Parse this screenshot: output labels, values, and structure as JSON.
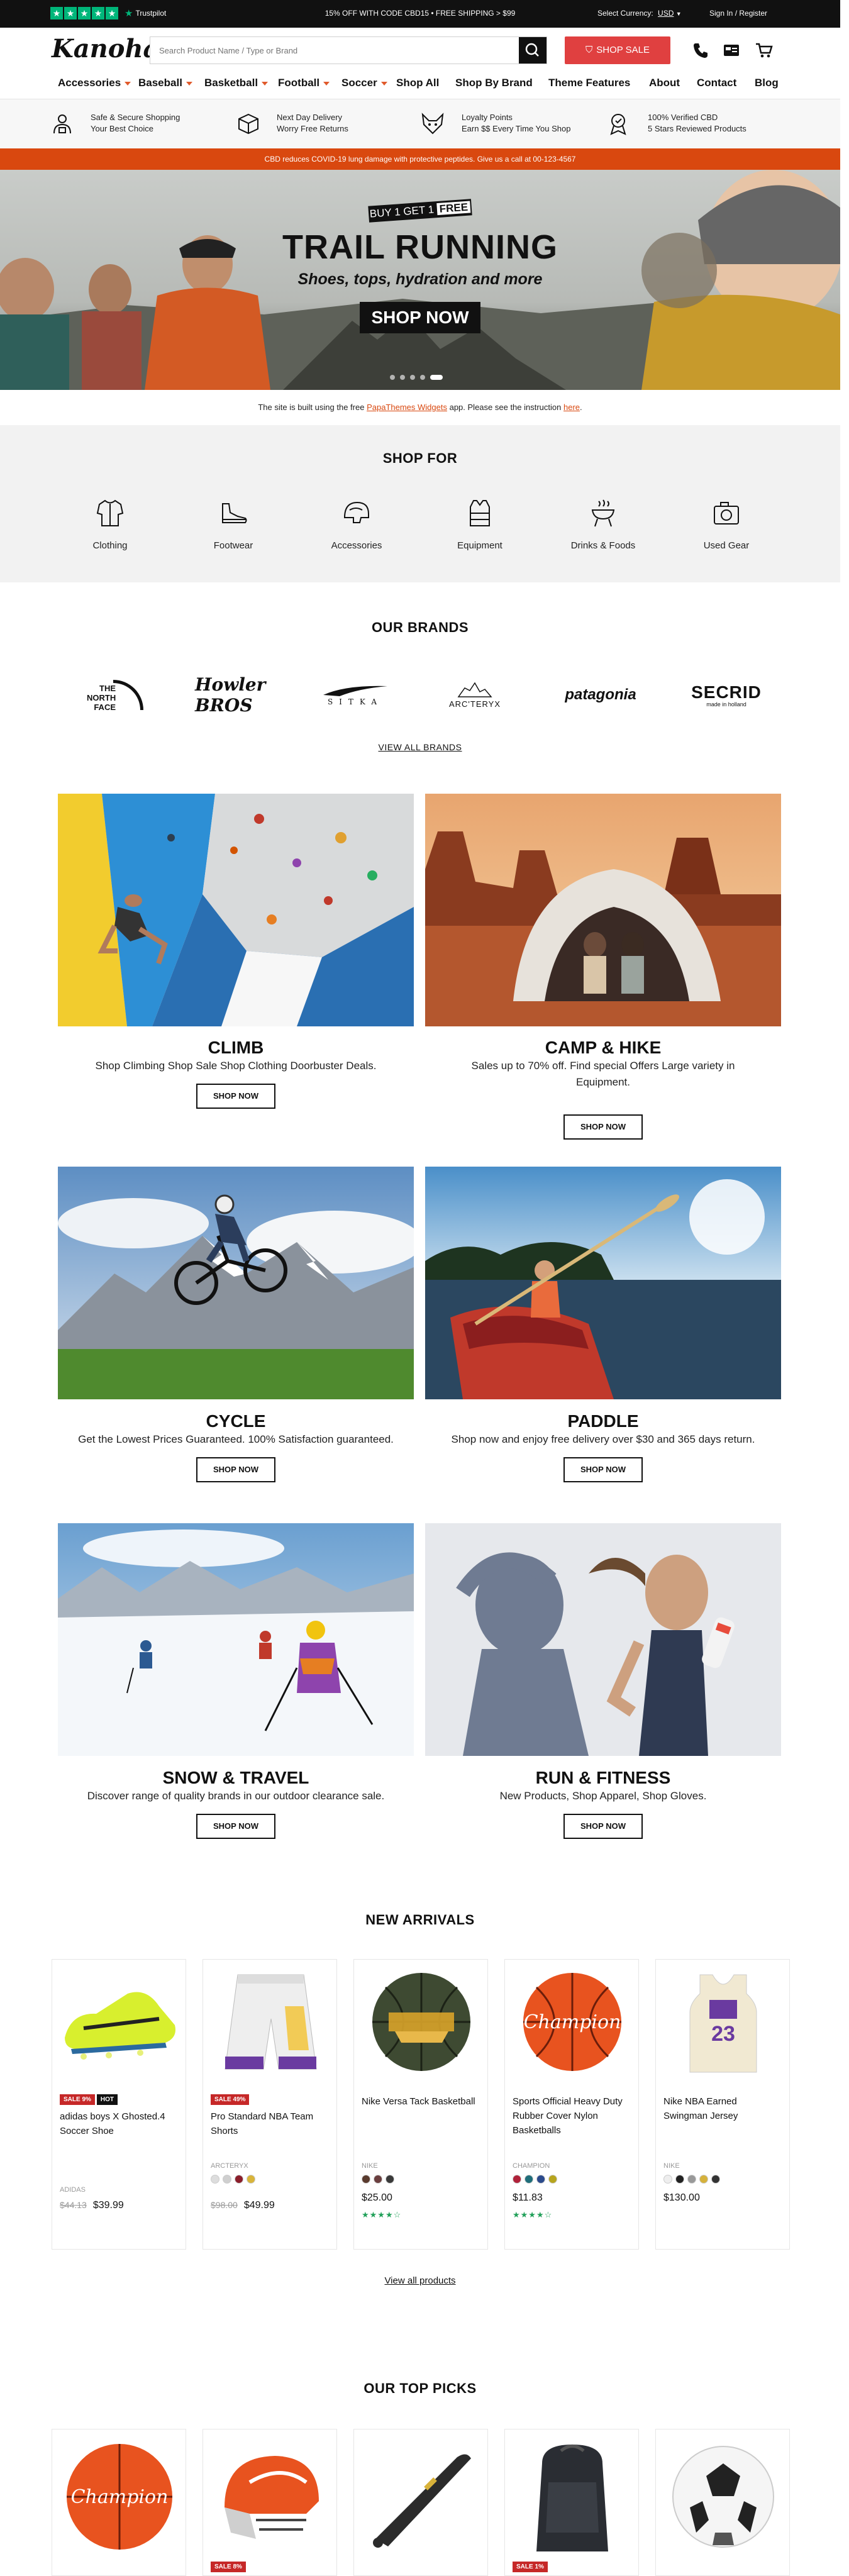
{
  "topbar": {
    "trustpilot": "Trustpilot",
    "promo": "15% OFF WITH CODE CBD15 • FREE SHIPPING > $99",
    "currency_label": "Select Currency:",
    "currency_value": "USD",
    "account": "Sign In / Register"
  },
  "header": {
    "logo": "Kanoha",
    "search_placeholder": "Search Product Name / Type or Brand",
    "shop_sale": "SHOP SALE",
    "nav": [
      "Accessories",
      "Baseball",
      "Basketball",
      "Football",
      "Soccer",
      "Shop All",
      "Shop By Brand",
      "Theme Features",
      "About",
      "Contact",
      "Blog"
    ]
  },
  "features": [
    {
      "icon": "shield-person-icon",
      "line1": "Safe & Secure Shopping",
      "line2": "Your Best Choice"
    },
    {
      "icon": "box-icon",
      "line1": "Next Day Delivery",
      "line2": "Worry Free Returns"
    },
    {
      "icon": "fox-icon",
      "line1": "Loyalty Points",
      "line2": "Earn $$ Every Time You Shop"
    },
    {
      "icon": "award-icon",
      "line1": "100% Verified CBD",
      "line2": "5 Stars Reviewed Products"
    }
  ],
  "promo_bar": "CBD reduces COVID-19 lung damage with protective peptides. Give us a call at 00-123-4567",
  "hero": {
    "tag_prefix": "BUY 1 GET 1",
    "tag_highlight": "FREE",
    "title": "TRAIL RUNNING",
    "subtitle": "Shoes, tops, hydration and more",
    "cta": "SHOP NOW"
  },
  "notice": {
    "pre": "The site is built using the free",
    "link1": "PapaThemes Widgets",
    "mid": "app. Please see the instruction",
    "link2": "here",
    "end": "."
  },
  "shop_for": {
    "title": "SHOP FOR",
    "items": [
      {
        "label": "Clothing",
        "icon": "shirt-icon"
      },
      {
        "label": "Footwear",
        "icon": "shoe-icon"
      },
      {
        "label": "Accessories",
        "icon": "helmet-icon"
      },
      {
        "label": "Equipment",
        "icon": "vest-icon"
      },
      {
        "label": "Drinks & Foods",
        "icon": "grill-icon"
      },
      {
        "label": "Used Gear",
        "icon": "camera-icon"
      }
    ]
  },
  "brands": {
    "title": "OUR BRANDS",
    "items": [
      "THE NORTH FACE",
      "Howler BROS",
      "SITKA",
      "ARC'TERYX",
      "patagonia",
      "SECRID"
    ],
    "secrid_tagline": "made in holland",
    "view_all": "VIEW ALL BRANDS"
  },
  "categories": [
    {
      "title": "CLIMB",
      "desc": "Shop Climbing Shop Sale Shop Clothing Doorbuster Deals.",
      "cta": "SHOP NOW"
    },
    {
      "title": "CAMP & HIKE",
      "desc": "Sales up to 70% off. Find special Offers Large variety in Equipment.",
      "cta": "SHOP NOW"
    },
    {
      "title": "CYCLE",
      "desc": "Get the Lowest Prices Guaranteed. 100% Satisfaction guaranteed.",
      "cta": "SHOP NOW"
    },
    {
      "title": "PADDLE",
      "desc": "Shop now and enjoy free delivery over $30 and 365 days return.",
      "cta": "SHOP NOW"
    },
    {
      "title": "SNOW & TRAVEL",
      "desc": "Discover range of quality brands in our outdoor clearance sale.",
      "cta": "SHOP NOW"
    },
    {
      "title": "RUN & FITNESS",
      "desc": "New Products, Shop Apparel, Shop Gloves.",
      "cta": "SHOP NOW"
    }
  ],
  "new_arrivals": {
    "title": "NEW ARRIVALS",
    "view_all": "View all products",
    "products": [
      {
        "name": "adidas boys X Ghosted.4 Soccer Shoe",
        "sale": "SALE 9%",
        "hot": "HOT",
        "brand": "ADIDAS",
        "old_price": "$44.13",
        "price": "$39.99",
        "swatches": [],
        "stars": ""
      },
      {
        "name": "Pro Standard NBA Team Shorts",
        "sale": "SALE 49%",
        "hot": "",
        "brand": "ARCTERYX",
        "old_price": "$98.00",
        "price": "$49.99",
        "swatches": [
          "#dddddd",
          "#cfcfcf",
          "#8b1e2b",
          "#d9b43a"
        ],
        "stars": ""
      },
      {
        "name": "Nike Versa Tack Basketball",
        "sale": "",
        "hot": "",
        "brand": "NIKE",
        "old_price": "",
        "price": "$25.00",
        "swatches": [
          "#5a3b2e",
          "#6b3f3f",
          "#3a3a3a"
        ],
        "stars": "★★★★☆"
      },
      {
        "name": "Sports Official Heavy Duty Rubber Cover Nylon Basketballs",
        "sale": "",
        "hot": "",
        "brand": "CHAMPION",
        "old_price": "",
        "price": "$11.83",
        "swatches": [
          "#b0223a",
          "#1f6e7a",
          "#2b4a8c",
          "#b7a51e"
        ],
        "stars": "★★★★☆"
      },
      {
        "name": "Nike NBA Earned Swingman Jersey",
        "sale": "",
        "hot": "",
        "brand": "NIKE",
        "old_price": "",
        "price": "$130.00",
        "swatches": [
          "#eeeeee",
          "#222222",
          "#999999",
          "#d6b23c",
          "#333333"
        ],
        "stars": ""
      }
    ]
  },
  "top_picks": {
    "title": "OUR TOP PICKS",
    "badges": [
      "",
      "SALE 8%",
      "",
      "SALE 1%",
      ""
    ]
  },
  "colors": {
    "accent": "#d9480f",
    "sale": "#c62828",
    "hot": "#111111",
    "trustpilot": "#00b67a"
  }
}
